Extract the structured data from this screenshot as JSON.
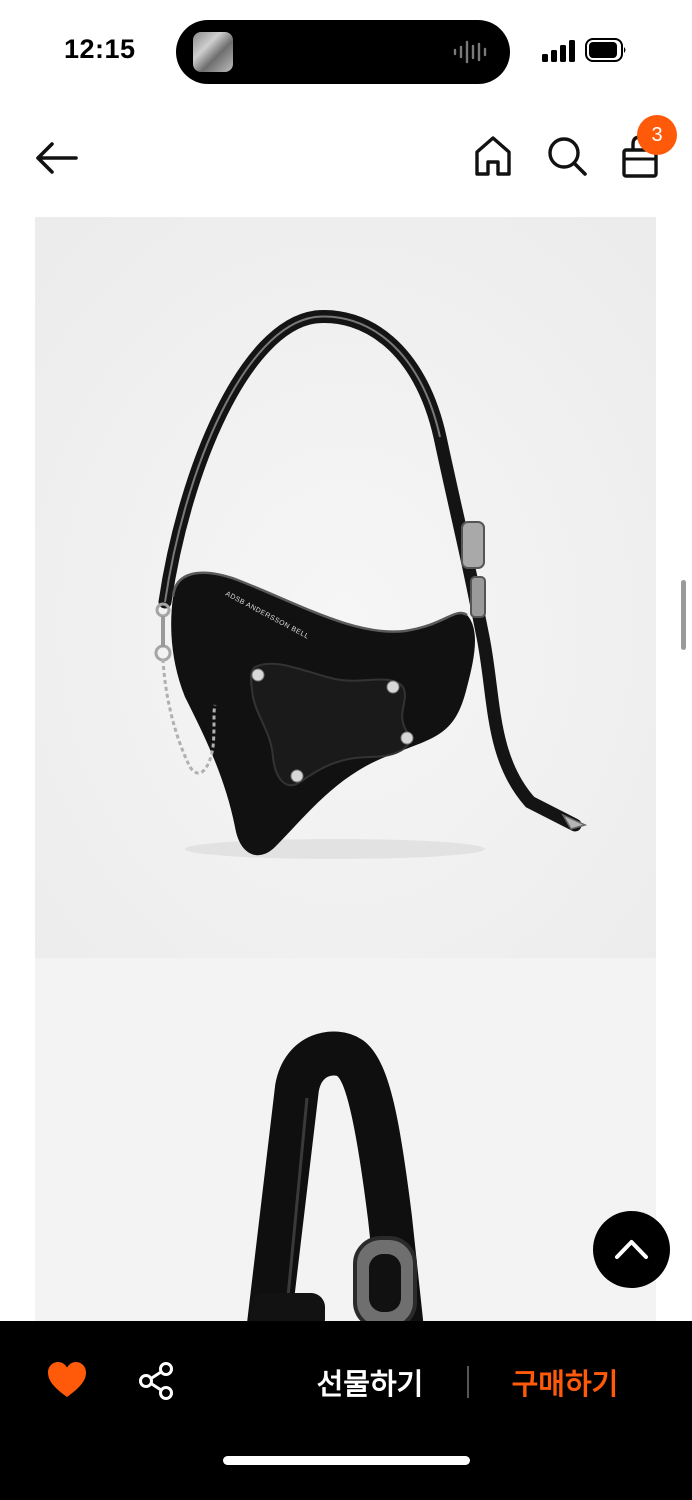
{
  "status_bar": {
    "time": "12:15",
    "icons": [
      "audio-waveform-icon",
      "cellular-signal-icon",
      "battery-icon"
    ]
  },
  "nav": {
    "icons": [
      "back-arrow-icon",
      "home-icon",
      "search-icon",
      "shopping-bag-icon"
    ],
    "cart_count": "3"
  },
  "product": {
    "bag_brand_print": "ADSB ANDERSSON BELL",
    "image_count_visible": 2
  },
  "floating": {
    "icon": "chevron-up-icon"
  },
  "bottom_bar": {
    "like_icon": "heart-icon",
    "share_icon": "share-icon",
    "gift_label": "선물하기",
    "buy_label": "구매하기"
  },
  "colors": {
    "accent": "#ff5a0a",
    "bar_background": "#000000",
    "image_background": "#f1f1f1"
  }
}
